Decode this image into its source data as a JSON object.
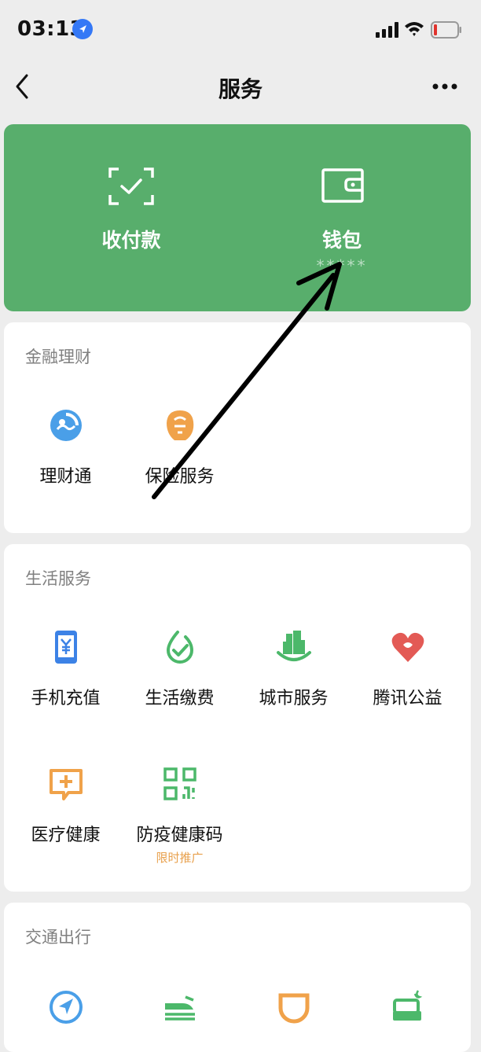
{
  "status_bar": {
    "time": "03:13"
  },
  "nav": {
    "title": "服务"
  },
  "pay_card": {
    "items": [
      {
        "label": "收付款",
        "icon": "scan-check-icon"
      },
      {
        "label": "钱包",
        "sub": "*****",
        "icon": "wallet-icon"
      }
    ],
    "color": "#58ae6c"
  },
  "sections": {
    "finance": {
      "title": "金融理财",
      "items": [
        {
          "label": "理财通",
          "icon": "licaitong-icon",
          "color": "#4a9fe8"
        },
        {
          "label": "保险服务",
          "icon": "insurance-icon",
          "color": "#f0a24a"
        }
      ]
    },
    "life": {
      "title": "生活服务",
      "items": [
        {
          "label": "手机充值",
          "icon": "phone-recharge-icon",
          "color": "#3c82e6"
        },
        {
          "label": "生活缴费",
          "icon": "utility-bill-icon",
          "color": "#4cb86a"
        },
        {
          "label": "城市服务",
          "icon": "city-service-icon",
          "color": "#4cb86a"
        },
        {
          "label": "腾讯公益",
          "icon": "charity-heart-icon",
          "color": "#e35a55"
        },
        {
          "label": "医疗健康",
          "icon": "medical-icon",
          "color": "#f0a24a"
        },
        {
          "label": "防疫健康码",
          "badge": "限时推广",
          "icon": "qr-code-icon",
          "color": "#4cb86a"
        }
      ]
    },
    "transport": {
      "title": "交通出行",
      "items": [
        {
          "icon": "navigation-icon",
          "color": "#4a9fe8"
        },
        {
          "icon": "train-icon",
          "color": "#4cb86a"
        },
        {
          "icon": "didi-icon",
          "color": "#f0a24a"
        },
        {
          "icon": "hotel-bed-icon",
          "color": "#4cb86a"
        }
      ]
    }
  },
  "annotation": {
    "type": "arrow",
    "color": "#000000"
  }
}
